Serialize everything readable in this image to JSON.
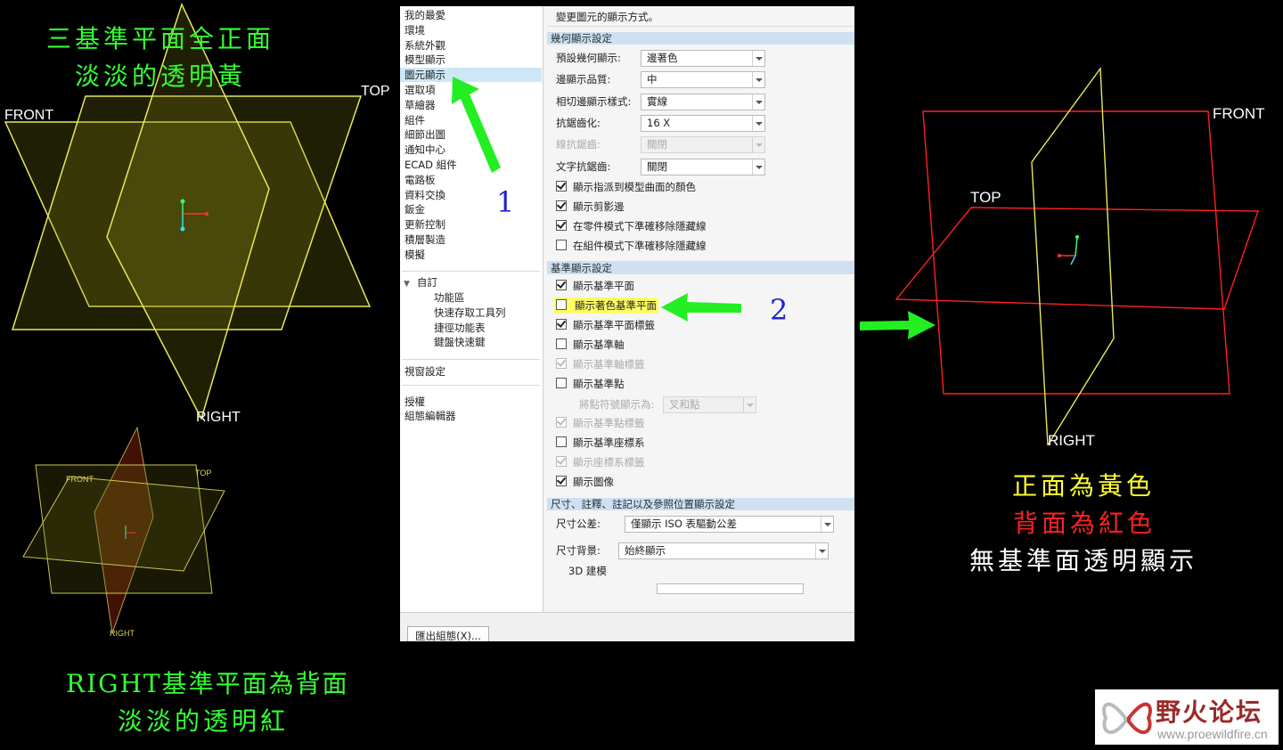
{
  "captions": {
    "top_left_line1": "三基準平面全正面",
    "top_left_line2": "淡淡的透明黃",
    "bottom_left_line1": "RIGHT基準平面為背面",
    "bottom_left_line2": "淡淡的透明紅",
    "right_line1": "正面為黃色",
    "right_line2": "背面為紅色",
    "right_line3": "無基準面透明顯示"
  },
  "plane_labels": {
    "front": "FRONT",
    "top": "TOP",
    "right": "RIGHT"
  },
  "annotations": {
    "step1": "1",
    "step2": "2"
  },
  "colors": {
    "caption_green": "#33ff33",
    "caption_yellow": "#ffff33",
    "caption_red": "#ff2222",
    "plane_yellow": "#e8e85a",
    "plane_red": "#ff2020",
    "arrow_green": "#22ee22",
    "step_blue": "#2222cc"
  },
  "dialog": {
    "nav": {
      "items": [
        "我的最愛",
        "環境",
        "系統外觀",
        "模型顯示",
        "圖元顯示",
        "選取項",
        "草繪器",
        "組件",
        "細節出圖",
        "通知中心",
        "ECAD 組件",
        "電路板",
        "資料交換",
        "鈑金",
        "更新控制",
        "積層製造",
        "模擬"
      ],
      "selected_index": 4,
      "custom_group": "自訂",
      "custom_items": [
        "功能區",
        "快速存取工具列",
        "捷徑功能表",
        "鍵盤快速鍵"
      ],
      "window_settings": "視窗設定",
      "license": "授權",
      "config_editor": "組態編輯器"
    },
    "panel": {
      "header": "變更圖元的顯示方式。",
      "geometry_section": "幾何顯示設定",
      "geometry_rows": [
        {
          "label": "預設幾何顯示:",
          "value": "邊著色",
          "disabled": false
        },
        {
          "label": "邊顯示品質:",
          "value": "中",
          "disabled": false
        },
        {
          "label": "相切邊顯示樣式:",
          "value": "實線",
          "disabled": false
        },
        {
          "label": "抗鋸齒化:",
          "value": "16 X",
          "disabled": false
        },
        {
          "label": "線抗鋸齒:",
          "value": "關閉",
          "disabled": true
        },
        {
          "label": "文字抗鋸齒:",
          "value": "關閉",
          "disabled": false
        }
      ],
      "geometry_checks": [
        {
          "label": "顯示指派到模型曲面的顏色",
          "checked": true
        },
        {
          "label": "顯示剪影邊",
          "checked": true
        },
        {
          "label": "在零件模式下準確移除隱藏線",
          "checked": true
        },
        {
          "label": "在組件模式下準確移除隱藏線",
          "checked": false
        }
      ],
      "datum_section": "基準顯示設定",
      "datum_checks": [
        {
          "label": "顯示基準平面",
          "checked": true,
          "disabled": false
        },
        {
          "label": "顯示著色基準平面",
          "checked": false,
          "disabled": false,
          "highlight": true
        },
        {
          "label": "顯示基準平面標籤",
          "checked": true,
          "disabled": false
        },
        {
          "label": "顯示基準軸",
          "checked": false,
          "disabled": false
        },
        {
          "label": "顯示基準軸標籤",
          "checked": true,
          "disabled": true
        },
        {
          "label": "顯示基準點",
          "checked": false,
          "disabled": false
        }
      ],
      "point_symbol_label": "將點符號顯示為:",
      "point_symbol_value": "叉和點",
      "datum_checks_2": [
        {
          "label": "顯示基準點標籤",
          "checked": true,
          "disabled": true
        },
        {
          "label": "顯示基準座標系",
          "checked": false,
          "disabled": false
        },
        {
          "label": "顯示座標系標籤",
          "checked": true,
          "disabled": true
        },
        {
          "label": "顯示圖像",
          "checked": true,
          "disabled": false
        }
      ],
      "dims_section": "尺寸、註釋、註記以及參照位置顯示設定",
      "tolerance_label": "尺寸公差:",
      "tolerance_value": "僅顯示 ISO 表驅動公差",
      "dim_bg_label": "尺寸背景:",
      "dim_bg_value": "始終顯示",
      "modeling_3d": "3D 建模"
    },
    "footer": {
      "export_button": "匯出組態(X)..."
    }
  },
  "logo": {
    "title": "野火论坛",
    "url": "www.proewildfire.cn"
  }
}
